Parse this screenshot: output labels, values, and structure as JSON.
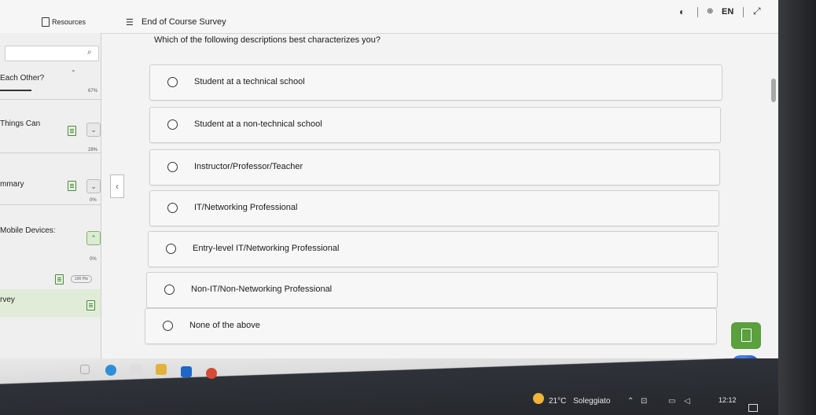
{
  "header": {
    "resources_label": "Resources",
    "course_title": "End of Course Survey",
    "language": "EN"
  },
  "sidebar": {
    "search_placeholder": "",
    "items": [
      {
        "label": "Each Other?",
        "progress": "67%"
      },
      {
        "label": "Things Can",
        "progress": "28%"
      },
      {
        "label": "mmary",
        "progress": "0%"
      },
      {
        "label": "Mobile Devices:",
        "progress": "0%"
      },
      {
        "label": "",
        "progress": "100 Pts"
      },
      {
        "label": "rvey",
        "progress": ""
      }
    ]
  },
  "survey": {
    "question": "Which of the following descriptions best characterizes you?",
    "options": [
      "Student at a technical school",
      "Student at a non-technical school",
      "Instructor/Professor/Teacher",
      "IT/Networking Professional",
      "Entry-level IT/Networking Professional",
      "Non-IT/Non-Networking Professional",
      "None of the above"
    ]
  },
  "taskbar": {
    "weather_temp": "21°C",
    "weather_desc": "Soleggiato",
    "time": "12:12"
  },
  "colors": {
    "accent_green": "#5aa03d",
    "taskbar_dark": "#25272c",
    "option_bg": "#f7f7f7"
  }
}
